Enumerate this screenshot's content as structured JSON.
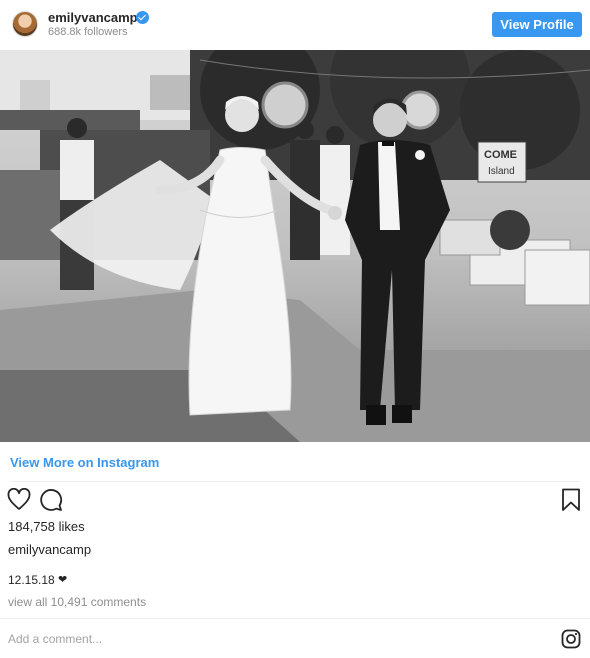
{
  "post": {
    "username": "emilyvancamp",
    "followers": "688.8k followers",
    "view_profile_label": "View Profile",
    "view_more_label": "View More on Instagram",
    "likes": "184,758 likes",
    "caption_username": "emilyvancamp",
    "date": "12.15.18",
    "date_suffix": "❤",
    "view_all_comments": "view all 10,491 comments",
    "add_comment_placeholder": "Add a comment..."
  },
  "colors": {
    "accent": "#3897f0",
    "text": "#262626",
    "muted": "#8e8e8e"
  },
  "photo": {
    "signs": [
      "COME",
      "Island"
    ]
  },
  "icons": {
    "like": "heart-icon",
    "comment": "comment-icon",
    "save": "bookmark-icon",
    "verified": "verified-badge-icon",
    "instagram": "instagram-logo-icon"
  }
}
